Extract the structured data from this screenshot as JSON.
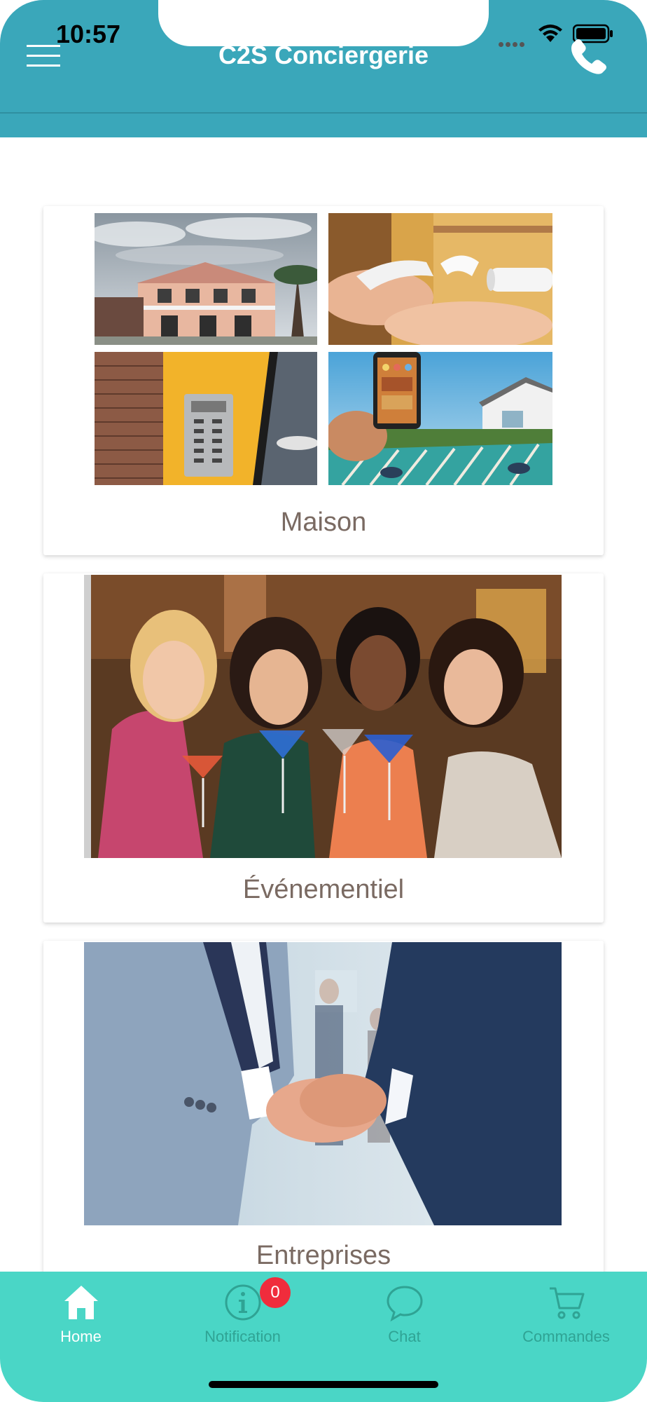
{
  "status_bar": {
    "time": "10:57"
  },
  "header": {
    "title": "C2S Conciergerie"
  },
  "cards": [
    {
      "label": "Maison"
    },
    {
      "label": "Événementiel"
    },
    {
      "label": "Entreprises"
    }
  ],
  "bottom_nav": {
    "items": [
      {
        "label": "Home",
        "icon": "home-icon",
        "active": true
      },
      {
        "label": "Notification",
        "icon": "info-icon",
        "badge": "0"
      },
      {
        "label": "Chat",
        "icon": "chat-bubble-icon"
      },
      {
        "label": "Commandes",
        "icon": "cart-icon"
      }
    ]
  },
  "colors": {
    "header": "#3aa7ba",
    "bottom_nav": "#4ad6c6",
    "badge": "#f02c3c",
    "card_label": "#7a6a62"
  }
}
